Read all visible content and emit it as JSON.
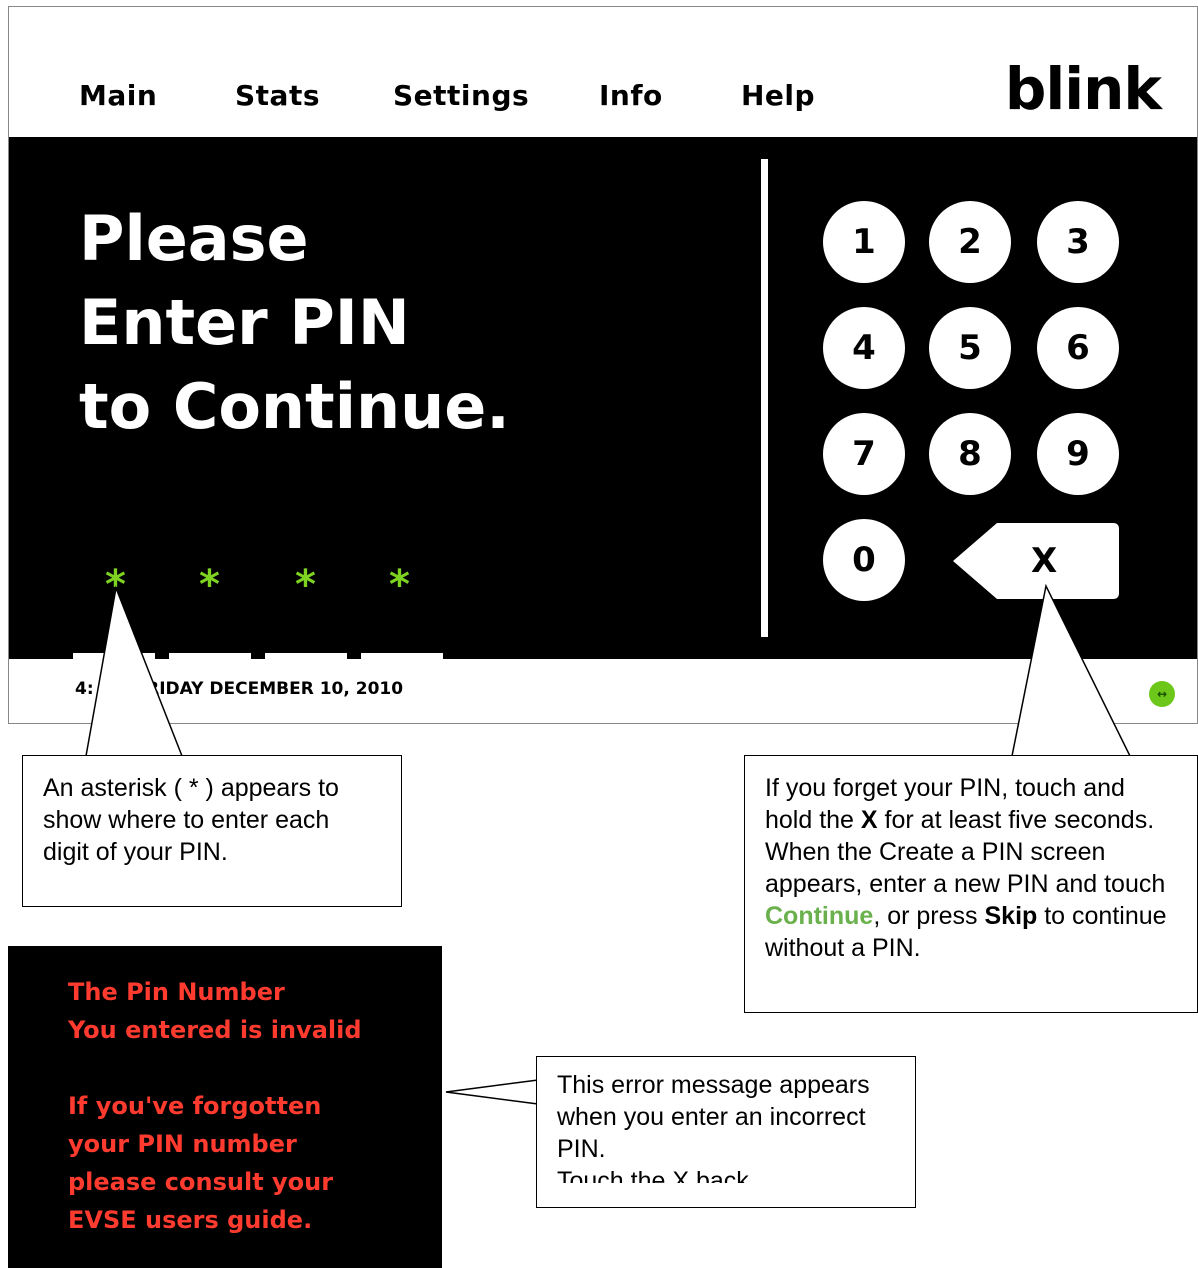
{
  "nav": {
    "items": [
      "Main",
      "Stats",
      "Settings",
      "Info",
      "Help"
    ],
    "logo": "blink"
  },
  "prompt": {
    "line1": "Please",
    "line2": "Enter PIN",
    "line3": "to Continue."
  },
  "pin": {
    "asterisk": "*",
    "asterisk_color": "#7ed321"
  },
  "keypad": {
    "keys": [
      "1",
      "2",
      "3",
      "4",
      "5",
      "6",
      "7",
      "8",
      "9",
      "0"
    ],
    "backspace_label": "X"
  },
  "footer": {
    "datetime": "4:  M | FRIDAY DECEMBER 10, 2010",
    "status_icon": "↔"
  },
  "callouts": {
    "asterisk": "An asterisk ( * ) appears to show where to enter each digit of your PIN.",
    "forgot": {
      "part1": "If you forget your PIN, touch and hold the ",
      "x": "X",
      "part2": " for at least five seconds. When the Create a PIN screen appears, enter a new PIN and touch ",
      "continue": "Continue",
      "part3": ", or press ",
      "skip": "Skip",
      "part4": " to continue without a PIN."
    },
    "error": "This error message appears when you enter an incorrect PIN.",
    "error_cut": "Touch the X back"
  },
  "error_panel": {
    "line1": "The Pin Number",
    "line2": "You entered is invalid",
    "line3": "If you've forgotten",
    "line4": "your PIN number",
    "line5": "please consult your",
    "line6": "EVSE users guide.",
    "color": "#ff3b2f"
  }
}
